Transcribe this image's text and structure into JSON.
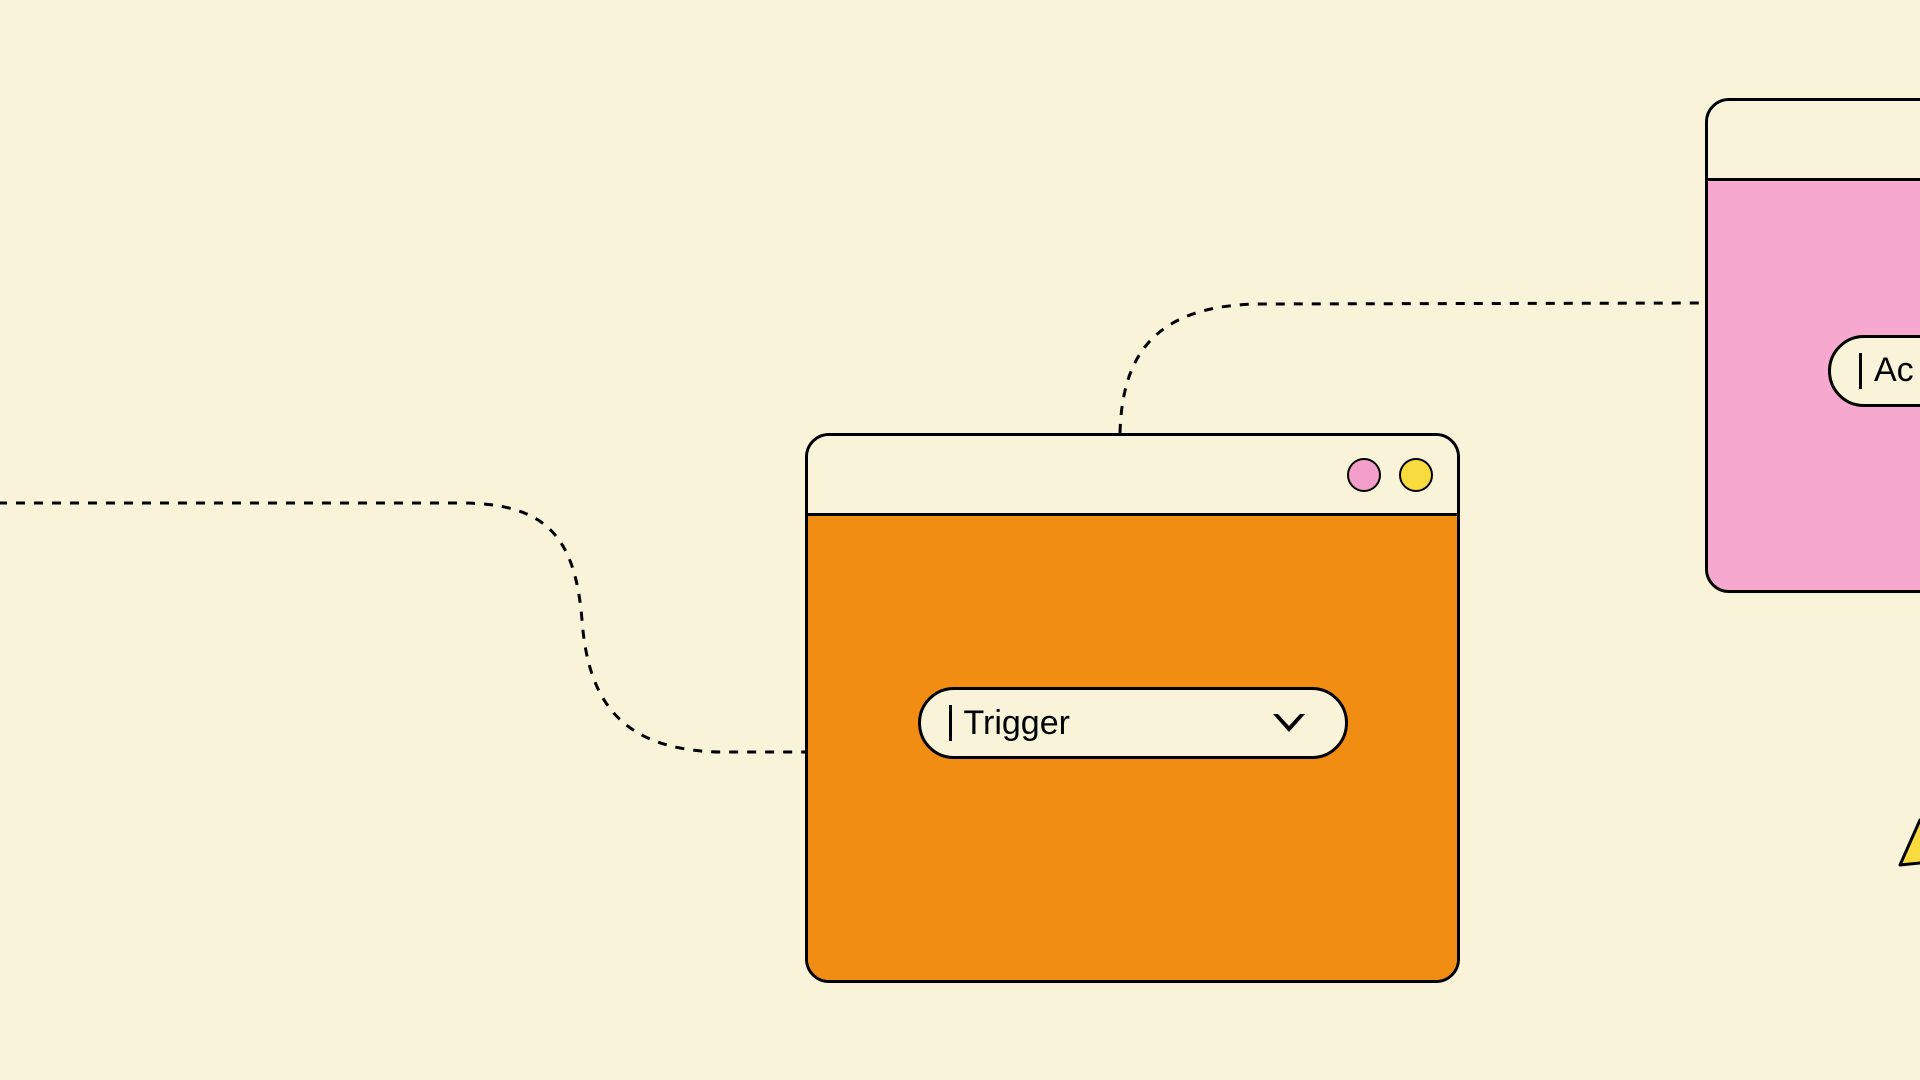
{
  "diagram": {
    "background_color": "#F9F4D9",
    "nodes": {
      "trigger": {
        "dropdown_label": "Trigger",
        "body_color": "#F18D13",
        "controls": [
          "pink",
          "yellow"
        ]
      },
      "action": {
        "dropdown_label": "Ac",
        "body_color": "#F7A8CE",
        "controls": []
      }
    },
    "colors": {
      "pink_dot": "#F29EC8",
      "yellow_dot": "#F8DB3E",
      "orange": "#F18D13",
      "pink_body": "#F7A8CE",
      "cream": "#F9F4D9",
      "stroke": "#000000"
    }
  }
}
